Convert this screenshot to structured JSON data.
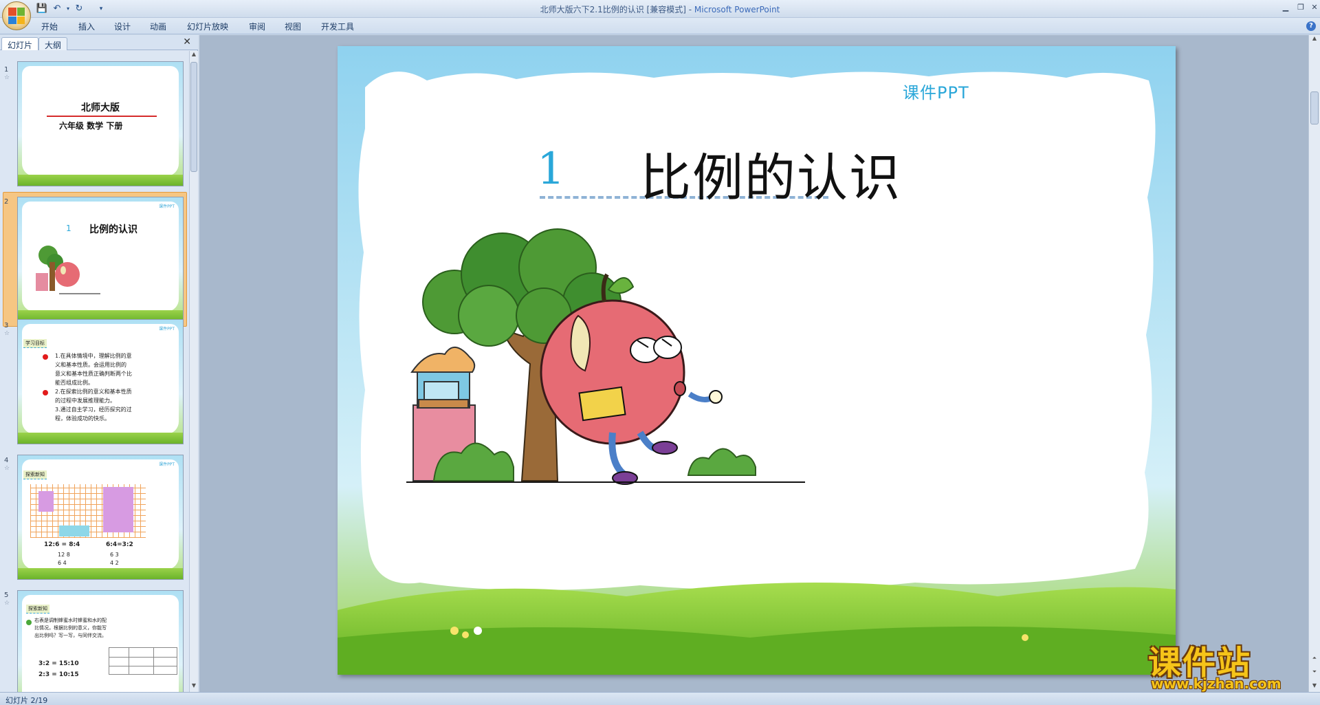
{
  "window": {
    "title": "北师大版六下2.1比例的认识 [兼容模式]",
    "app_name": "Microsoft PowerPoint"
  },
  "ribbon": {
    "tabs": [
      "开始",
      "插入",
      "设计",
      "动画",
      "幻灯片放映",
      "审阅",
      "视图",
      "开发工具"
    ]
  },
  "left_pane": {
    "tabs": [
      "幻灯片",
      "大纲"
    ],
    "thumbnails": [
      {
        "num": "1",
        "title": "北师大版",
        "subtitle": "六年级  数学  下册"
      },
      {
        "num": "2",
        "title_num": "1",
        "title": "比例的认识",
        "selected": true
      },
      {
        "num": "3",
        "badge": "学习目标",
        "lines": [
          "1.在具体情境中，理解比例的意",
          "义和基本性质。会运用比例的",
          "意义和基本性质正确判断两个比",
          "能否组成比例。",
          "2.在探索比例的意义和基本性质",
          "的过程中发展推理能力。",
          "3.通过自主学习，经历探究的过",
          "程，体验成功的快乐。"
        ]
      },
      {
        "num": "4",
        "badge": "探索新知",
        "eq1": "12:6 = 8:4",
        "eq2": "6:4=3:2",
        "frac1": "12  8",
        "frac2": "6   3",
        "frac1b": "6   4",
        "frac2b": "4   2"
      },
      {
        "num": "5",
        "badge": "探索新知",
        "lines": [
          "右表是调制蜂蜜水时蜂蜜和水的配",
          "比情况，根据比例的意义，你能写",
          "出比例吗？写一写，与同伴交流。"
        ],
        "eq1": "3:2 = 15:10",
        "eq2": "2:3 = 10:15"
      }
    ]
  },
  "slide": {
    "logo": "课件PPT",
    "number": "1",
    "title": "比例的认识"
  },
  "status": {
    "slide_count": "幻灯片 2/19"
  },
  "watermark": {
    "text": "课件站",
    "url": "www.kjzhan.com"
  },
  "colors": {
    "accent_blue": "#2aa7d9",
    "title_black": "#111111",
    "apple_red": "#e66b74",
    "tree_green": "#3f8e2f"
  }
}
